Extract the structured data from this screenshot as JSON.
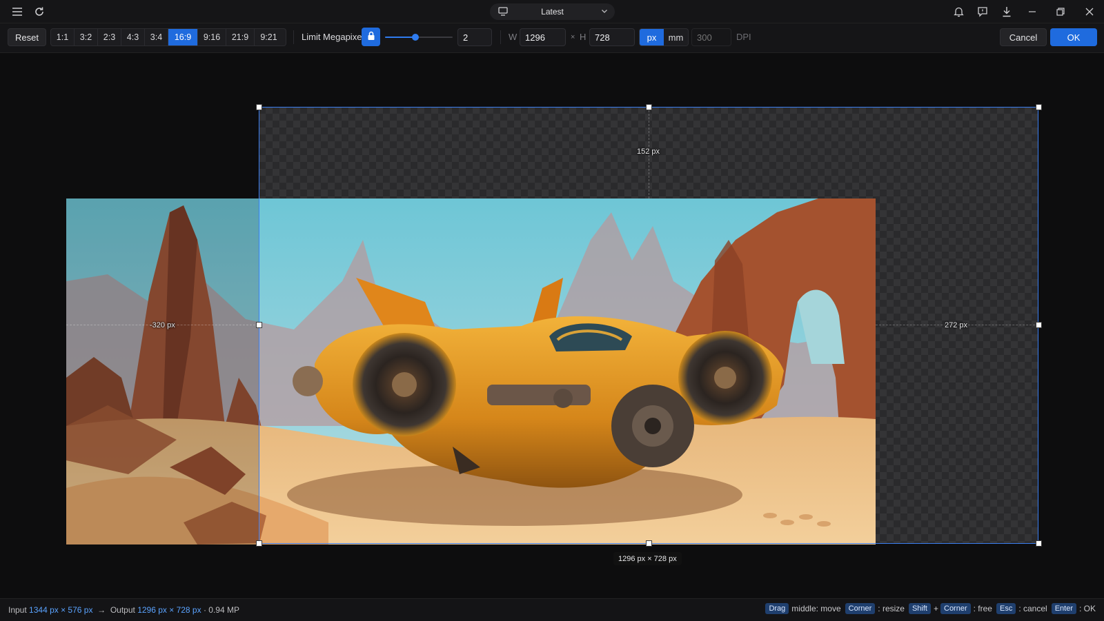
{
  "titlebar": {
    "version": "Latest",
    "icons": [
      "menu-icon",
      "refresh-icon",
      "monitor-icon",
      "chevron-down-icon",
      "bell-icon",
      "chat-icon",
      "download-icon",
      "minimize-icon",
      "restore-icon",
      "close-icon"
    ]
  },
  "toolbar": {
    "reset_label": "Reset",
    "ratios": [
      "1:1",
      "3:2",
      "2:3",
      "4:3",
      "3:4",
      "16:9",
      "9:16",
      "21:9",
      "9:21"
    ],
    "active_ratio": "16:9",
    "limit_megapixel_label": "Limit Megapixel",
    "megapixel_slider_fraction": 0.45,
    "megapixel_value": "2",
    "width_label": "W",
    "width_value": "1296",
    "times": "×",
    "height_label": "H",
    "height_value": "728",
    "unit_px": "px",
    "unit_mm": "mm",
    "dpi_placeholder": "300",
    "dpi_label": "DPI",
    "cancel_label": "Cancel",
    "ok_label": "OK",
    "accent_color": "#1f6bde"
  },
  "canvas": {
    "top_extension": "152 px",
    "left_offset": "-320 px",
    "right_extension": "272 px",
    "output_size": "1296 px × 728 px"
  },
  "status": {
    "input_label": "Input",
    "input_size": "1344 px × 576 px",
    "arrow": "→",
    "output_label": "Output",
    "output_size": "1296 px × 728 px",
    "output_mp": "· 0.94 MP",
    "hints": [
      {
        "keys": [
          "Drag"
        ],
        "text": "middle: move"
      },
      {
        "keys": [
          "Corner"
        ],
        "text": ": resize"
      },
      {
        "keys": [
          "Shift",
          "Corner"
        ],
        "text": ": free"
      },
      {
        "keys": [
          "Esc"
        ],
        "text": ": cancel"
      },
      {
        "keys": [
          "Enter"
        ],
        "text": ": OK"
      }
    ],
    "plus": "+"
  }
}
